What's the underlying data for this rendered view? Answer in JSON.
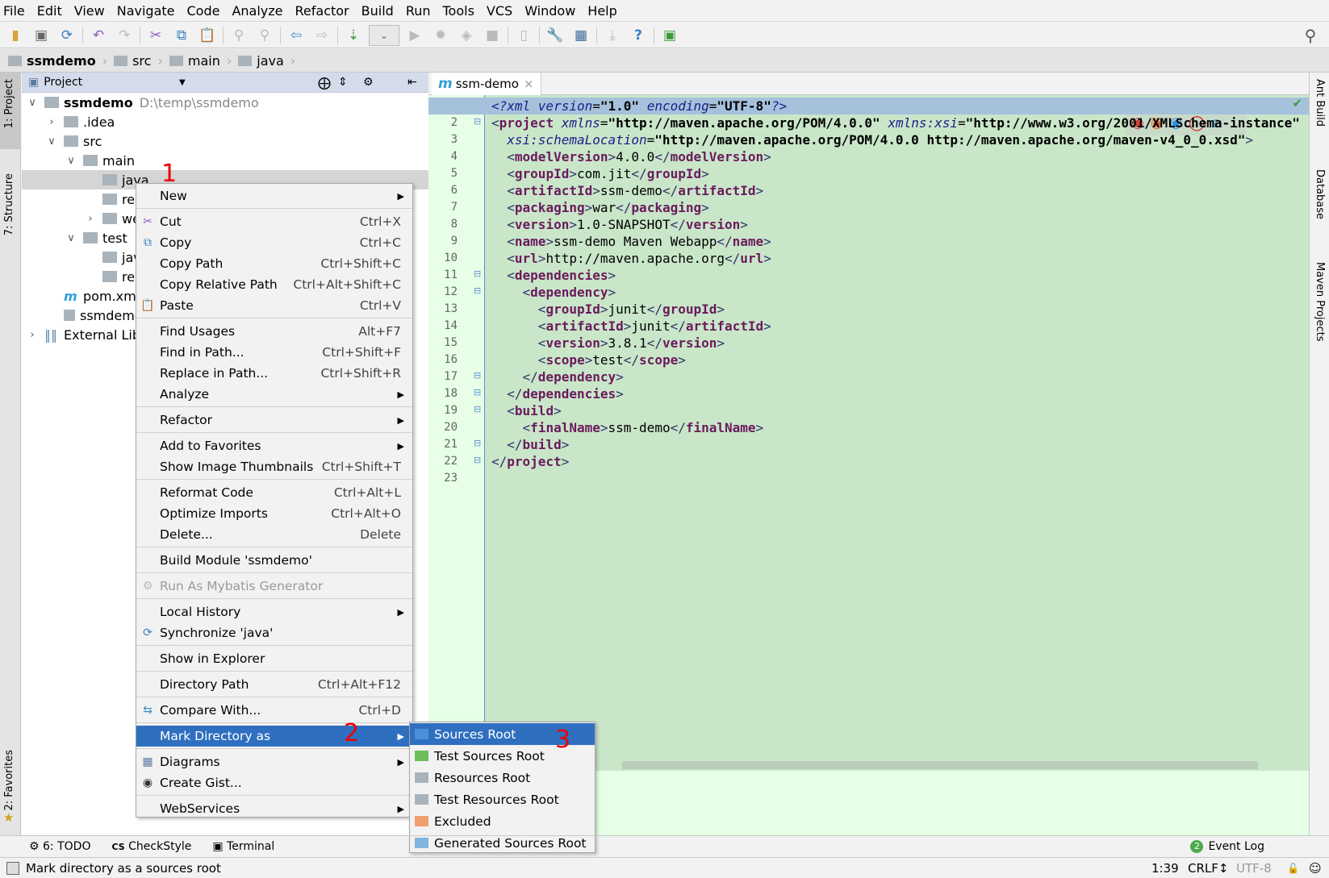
{
  "menubar": [
    "File",
    "Edit",
    "View",
    "Navigate",
    "Code",
    "Analyze",
    "Refactor",
    "Build",
    "Run",
    "Tools",
    "VCS",
    "Window",
    "Help"
  ],
  "breadcrumb": [
    "ssmdemo",
    "src",
    "main",
    "java"
  ],
  "left_strip": {
    "project": "1: Project",
    "structure": "7: Structure",
    "favorites": "2: Favorites"
  },
  "right_strip": {
    "ant": "Ant Build",
    "database": "Database",
    "maven": "Maven Projects"
  },
  "project_panel": {
    "title": "Project",
    "tree": [
      {
        "label": "ssmdemo",
        "path": "D:\\temp\\ssmdemo",
        "arrow": "down",
        "depth": 0,
        "bold": true
      },
      {
        "label": ".idea",
        "arrow": "right",
        "depth": 1
      },
      {
        "label": "src",
        "arrow": "down",
        "depth": 1
      },
      {
        "label": "main",
        "arrow": "down",
        "depth": 2
      },
      {
        "label": "java",
        "arrow": "",
        "depth": 3,
        "selected": true
      },
      {
        "label": "resources",
        "arrow": "",
        "depth": 3
      },
      {
        "label": "webapp",
        "arrow": "right",
        "depth": 3
      },
      {
        "label": "test",
        "arrow": "down",
        "depth": 2
      },
      {
        "label": "java",
        "arrow": "",
        "depth": 3
      },
      {
        "label": "resources",
        "arrow": "",
        "depth": 3
      },
      {
        "label": "pom.xml",
        "arrow": "",
        "depth": 1,
        "icon": "maven"
      },
      {
        "label": "ssmdemo.iml",
        "arrow": "",
        "depth": 1,
        "icon": "file"
      },
      {
        "label": "External Libraries",
        "arrow": "right",
        "depth": 0,
        "icon": "lib"
      }
    ]
  },
  "editor": {
    "tab": "ssm-demo",
    "lines": [
      [
        [
          "<?",
          "pi"
        ],
        [
          "xml ",
          "pi"
        ],
        [
          "version",
          "at"
        ],
        [
          "=",
          "tx"
        ],
        [
          "\"1.0\"",
          "vl"
        ],
        [
          " ",
          "tx"
        ],
        [
          "encoding",
          "at"
        ],
        [
          "=",
          "tx"
        ],
        [
          "\"UTF-8\"",
          "vl"
        ],
        [
          "?>",
          "pi"
        ]
      ],
      [
        [
          "<",
          "br"
        ],
        [
          "project ",
          "tg"
        ],
        [
          "xmlns",
          "at"
        ],
        [
          "=",
          "tx"
        ],
        [
          "\"http://maven.apache.org/POM/4.0.0\"",
          "vl"
        ],
        [
          " ",
          "tx"
        ],
        [
          "xmlns:xsi",
          "at"
        ],
        [
          "=",
          "tx"
        ],
        [
          "\"http://www.w3.org/2001/XMLSchema-instance\"",
          "vl"
        ]
      ],
      [
        [
          "  ",
          "tx"
        ],
        [
          "xsi:schemaLocation",
          "at"
        ],
        [
          "=",
          "tx"
        ],
        [
          "\"http://maven.apache.org/POM/4.0.0 http://maven.apache.org/maven-v4_0_0.xsd\"",
          "vl"
        ],
        [
          ">",
          "br"
        ]
      ],
      [
        [
          "  <",
          "br"
        ],
        [
          "modelVersion",
          "tg"
        ],
        [
          ">",
          "br"
        ],
        [
          "4.0.0",
          "tx"
        ],
        [
          "</",
          "br"
        ],
        [
          "modelVersion",
          "tg"
        ],
        [
          ">",
          "br"
        ]
      ],
      [
        [
          "  <",
          "br"
        ],
        [
          "groupId",
          "tg"
        ],
        [
          ">",
          "br"
        ],
        [
          "com.jit",
          "tx"
        ],
        [
          "</",
          "br"
        ],
        [
          "groupId",
          "tg"
        ],
        [
          ">",
          "br"
        ]
      ],
      [
        [
          "  <",
          "br"
        ],
        [
          "artifactId",
          "tg"
        ],
        [
          ">",
          "br"
        ],
        [
          "ssm-demo",
          "tx"
        ],
        [
          "</",
          "br"
        ],
        [
          "artifactId",
          "tg"
        ],
        [
          ">",
          "br"
        ]
      ],
      [
        [
          "  <",
          "br"
        ],
        [
          "packaging",
          "tg"
        ],
        [
          ">",
          "br"
        ],
        [
          "war",
          "tx"
        ],
        [
          "</",
          "br"
        ],
        [
          "packaging",
          "tg"
        ],
        [
          ">",
          "br"
        ]
      ],
      [
        [
          "  <",
          "br"
        ],
        [
          "version",
          "tg"
        ],
        [
          ">",
          "br"
        ],
        [
          "1.0-SNAPSHOT",
          "tx"
        ],
        [
          "</",
          "br"
        ],
        [
          "version",
          "tg"
        ],
        [
          ">",
          "br"
        ]
      ],
      [
        [
          "  <",
          "br"
        ],
        [
          "name",
          "tg"
        ],
        [
          ">",
          "br"
        ],
        [
          "ssm-demo Maven Webapp",
          "tx"
        ],
        [
          "</",
          "br"
        ],
        [
          "name",
          "tg"
        ],
        [
          ">",
          "br"
        ]
      ],
      [
        [
          "  <",
          "br"
        ],
        [
          "url",
          "tg"
        ],
        [
          ">",
          "br"
        ],
        [
          "http://maven.apache.org",
          "tx"
        ],
        [
          "</",
          "br"
        ],
        [
          "url",
          "tg"
        ],
        [
          ">",
          "br"
        ]
      ],
      [
        [
          "  <",
          "br"
        ],
        [
          "dependencies",
          "tg"
        ],
        [
          ">",
          "br"
        ]
      ],
      [
        [
          "    <",
          "br"
        ],
        [
          "dependency",
          "tg"
        ],
        [
          ">",
          "br"
        ]
      ],
      [
        [
          "      <",
          "br"
        ],
        [
          "groupId",
          "tg"
        ],
        [
          ">",
          "br"
        ],
        [
          "junit",
          "tx"
        ],
        [
          "</",
          "br"
        ],
        [
          "groupId",
          "tg"
        ],
        [
          ">",
          "br"
        ]
      ],
      [
        [
          "      <",
          "br"
        ],
        [
          "artifactId",
          "tg"
        ],
        [
          ">",
          "br"
        ],
        [
          "junit",
          "tx"
        ],
        [
          "</",
          "br"
        ],
        [
          "artifactId",
          "tg"
        ],
        [
          ">",
          "br"
        ]
      ],
      [
        [
          "      <",
          "br"
        ],
        [
          "version",
          "tg"
        ],
        [
          ">",
          "br"
        ],
        [
          "3.8.1",
          "tx"
        ],
        [
          "</",
          "br"
        ],
        [
          "version",
          "tg"
        ],
        [
          ">",
          "br"
        ]
      ],
      [
        [
          "      <",
          "br"
        ],
        [
          "scope",
          "tg"
        ],
        [
          ">",
          "br"
        ],
        [
          "test",
          "tx"
        ],
        [
          "</",
          "br"
        ],
        [
          "scope",
          "tg"
        ],
        [
          ">",
          "br"
        ]
      ],
      [
        [
          "    </",
          "br"
        ],
        [
          "dependency",
          "tg"
        ],
        [
          ">",
          "br"
        ]
      ],
      [
        [
          "  </",
          "br"
        ],
        [
          "dependencies",
          "tg"
        ],
        [
          ">",
          "br"
        ]
      ],
      [
        [
          "  <",
          "br"
        ],
        [
          "build",
          "tg"
        ],
        [
          ">",
          "br"
        ]
      ],
      [
        [
          "    <",
          "br"
        ],
        [
          "finalName",
          "tg"
        ],
        [
          ">",
          "br"
        ],
        [
          "ssm-demo",
          "tx"
        ],
        [
          "</",
          "br"
        ],
        [
          "finalName",
          "tg"
        ],
        [
          ">",
          "br"
        ]
      ],
      [
        [
          "  </",
          "br"
        ],
        [
          "build",
          "tg"
        ],
        [
          ">",
          "br"
        ]
      ],
      [
        [
          "</",
          "br"
        ],
        [
          "project",
          "tg"
        ],
        [
          ">",
          "br"
        ]
      ],
      []
    ]
  },
  "context_menu": [
    {
      "label": "New",
      "submenu": true
    },
    "sep",
    {
      "label": "Cut",
      "shortcut": "Ctrl+X",
      "icon": "scissors"
    },
    {
      "label": "Copy",
      "shortcut": "Ctrl+C",
      "icon": "copy"
    },
    {
      "label": "Copy Path",
      "shortcut": "Ctrl+Shift+C"
    },
    {
      "label": "Copy Relative Path",
      "shortcut": "Ctrl+Alt+Shift+C"
    },
    {
      "label": "Paste",
      "shortcut": "Ctrl+V",
      "icon": "paste"
    },
    "sep",
    {
      "label": "Find Usages",
      "shortcut": "Alt+F7"
    },
    {
      "label": "Find in Path...",
      "shortcut": "Ctrl+Shift+F"
    },
    {
      "label": "Replace in Path...",
      "shortcut": "Ctrl+Shift+R"
    },
    {
      "label": "Analyze",
      "submenu": true
    },
    "sep",
    {
      "label": "Refactor",
      "submenu": true
    },
    "sep",
    {
      "label": "Add to Favorites",
      "submenu": true
    },
    {
      "label": "Show Image Thumbnails",
      "shortcut": "Ctrl+Shift+T"
    },
    "sep",
    {
      "label": "Reformat Code",
      "shortcut": "Ctrl+Alt+L"
    },
    {
      "label": "Optimize Imports",
      "shortcut": "Ctrl+Alt+O"
    },
    {
      "label": "Delete...",
      "shortcut": "Delete"
    },
    "sep",
    {
      "label": "Build Module 'ssmdemo'"
    },
    "sep",
    {
      "label": "Run As Mybatis Generator",
      "disabled": true,
      "icon": "mybatis"
    },
    "sep",
    {
      "label": "Local History",
      "submenu": true
    },
    {
      "label": "Synchronize 'java'",
      "icon": "sync"
    },
    "sep",
    {
      "label": "Show in Explorer"
    },
    "sep",
    {
      "label": "Directory Path",
      "shortcut": "Ctrl+Alt+F12"
    },
    "sep",
    {
      "label": "Compare With...",
      "shortcut": "Ctrl+D",
      "icon": "compare"
    },
    "sep",
    {
      "label": "Mark Directory as",
      "submenu": true,
      "selected": true
    },
    "sep",
    {
      "label": "Diagrams",
      "submenu": true,
      "icon": "diagram"
    },
    {
      "label": "Create Gist...",
      "icon": "github"
    },
    "sep",
    {
      "label": "WebServices",
      "submenu": true
    }
  ],
  "submenu": [
    {
      "label": "Sources Root",
      "color": "#4a8fd8",
      "selected": true
    },
    {
      "label": "Test Sources Root",
      "color": "#6bbf5a"
    },
    {
      "label": "Resources Root",
      "color": "#a9b3bb"
    },
    {
      "label": "Test Resources Root",
      "color": "#a9b3bb"
    },
    {
      "label": "Excluded",
      "color": "#f0a070"
    },
    {
      "label": "Generated Sources Root",
      "color": "#7fb5e0"
    }
  ],
  "annotations": [
    "1",
    "2",
    "3"
  ],
  "bottom_tools": [
    "6: TODO",
    "CheckStyle",
    "Terminal"
  ],
  "event_log": {
    "label": "Event Log",
    "count": "2"
  },
  "status": {
    "message": "Mark directory as a sources root",
    "position": "1:39",
    "line_sep": "CRLF↕",
    "encoding": "UTF-8"
  }
}
